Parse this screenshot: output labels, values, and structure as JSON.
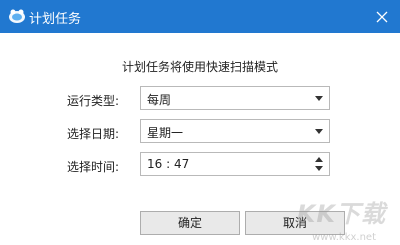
{
  "window": {
    "title": "计划任务",
    "accent": "#2178d0"
  },
  "dialog": {
    "subtitle": "计划任务将使用快速扫描模式",
    "run_type": {
      "label": "运行类型:",
      "value": "每周"
    },
    "select_date": {
      "label": "选择日期:",
      "value": "星期一"
    },
    "select_time": {
      "label": "选择时间:",
      "value": "16 : 47"
    },
    "ok_label": "确定",
    "cancel_label": "取消"
  },
  "watermark": {
    "brand": "KK下载",
    "url": "www.kkx.net"
  }
}
